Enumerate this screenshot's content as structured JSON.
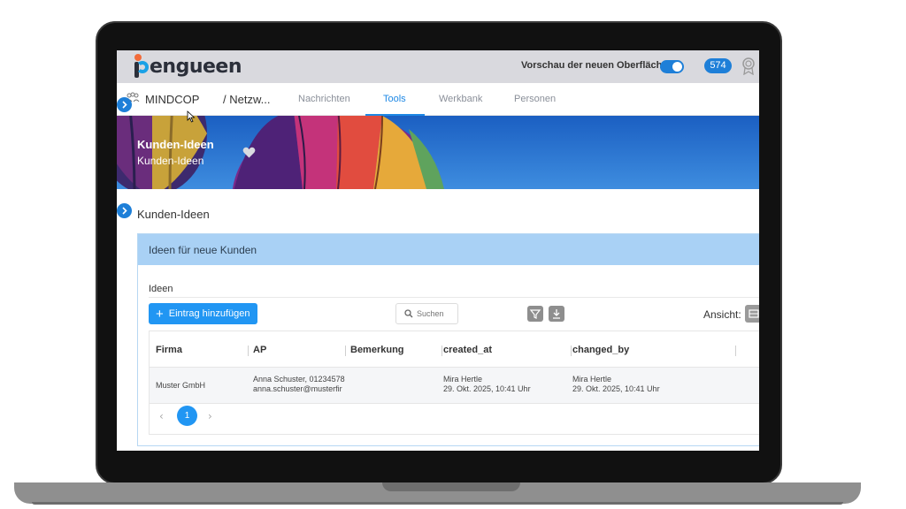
{
  "app": {
    "logo_text": "engueen",
    "preview_label": "Vorschau der neuen Oberfläche",
    "notification_count": "574",
    "colors": {
      "accent": "#1e88e5",
      "header_bg": "#d9d9de",
      "card_header_bg": "#a9d1f5"
    }
  },
  "nav": {
    "brand": "MINDCOP",
    "crumb": "/ Netzw...",
    "tabs": [
      {
        "label": "Nachrichten",
        "active": false
      },
      {
        "label": "Tools",
        "active": true
      },
      {
        "label": "Werkbank",
        "active": false
      },
      {
        "label": "Personen",
        "active": false
      }
    ]
  },
  "hero": {
    "title": "Kunden-Ideen",
    "subtitle": "Kunden-Ideen"
  },
  "section": {
    "title": "Kunden-Ideen"
  },
  "card": {
    "header": "Ideen für neue Kunden",
    "subheader": "Ideen",
    "add_button": "Eintrag hinzufügen",
    "search_placeholder": "Suchen",
    "view_label": "Ansicht:",
    "table": {
      "columns": [
        "Firma",
        "AP",
        "Bemerkung",
        "created_at",
        "changed_by"
      ],
      "rows": [
        {
          "firma": "Muster GmbH",
          "ap_line1": "Anna Schuster, 01234578",
          "ap_line2": "anna.schuster@musterfir",
          "bemerkung": "",
          "created_by": "Mira Hertle",
          "created_at": "29. Okt. 2025, 10:41 Uhr",
          "changed_by": "Mira Hertle",
          "changed_at": "29. Okt. 2025, 10:41 Uhr"
        }
      ]
    },
    "pagination": {
      "current_page": "1"
    }
  }
}
